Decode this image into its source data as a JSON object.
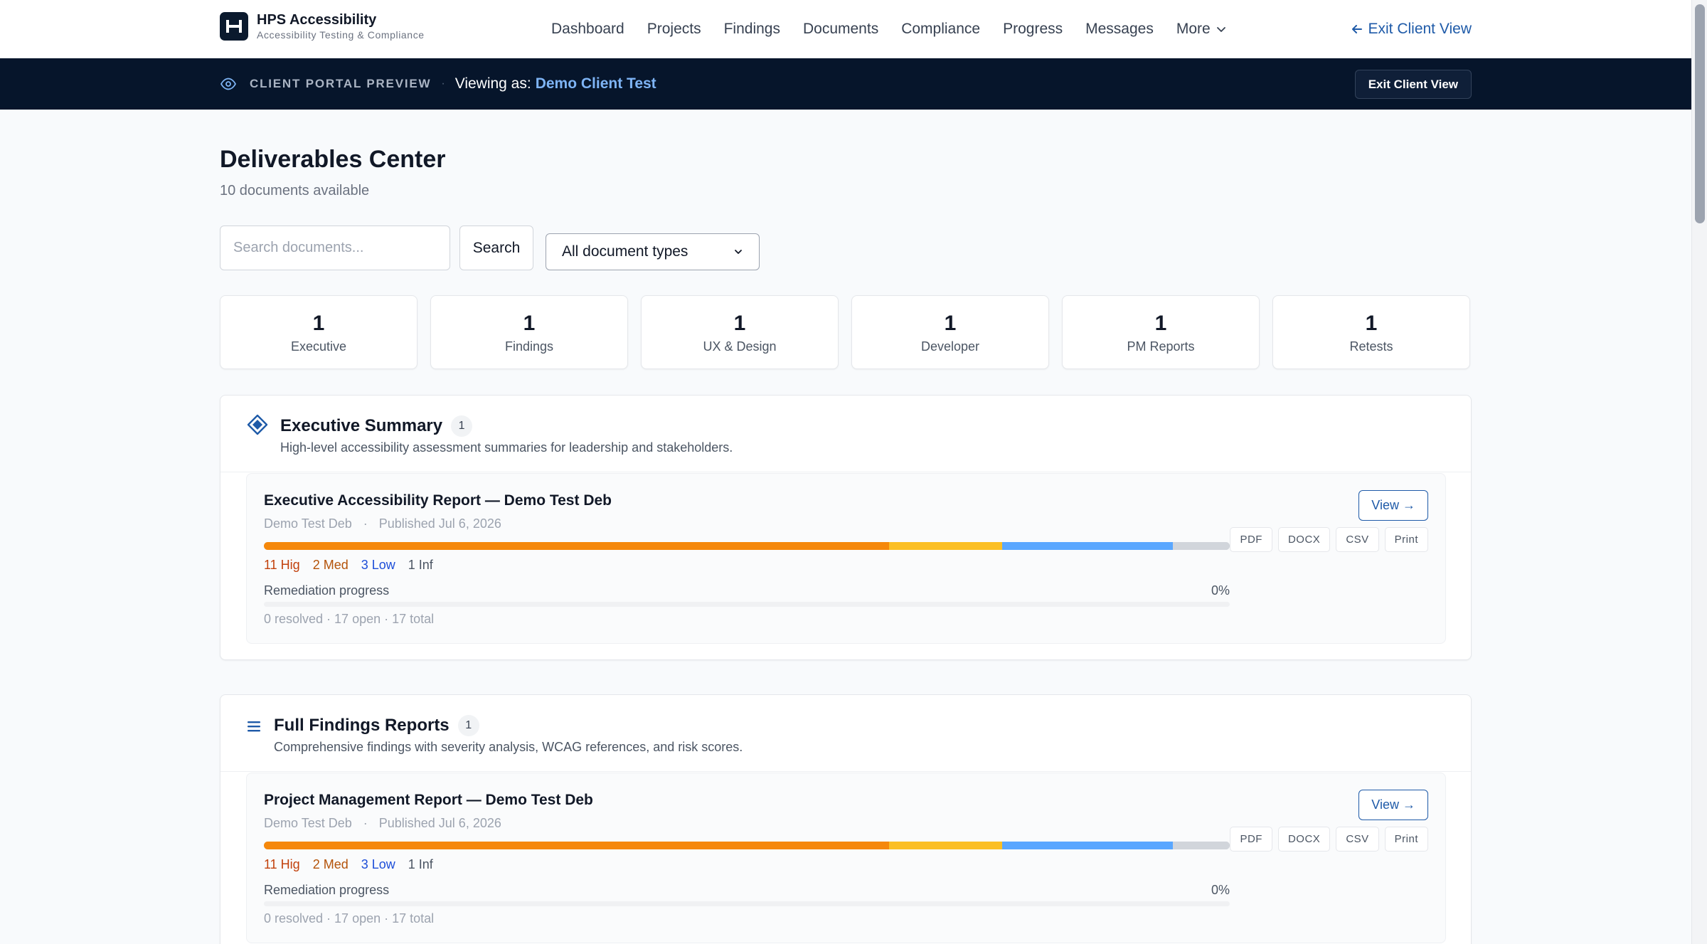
{
  "nav": {
    "brand_name": "HPS Accessibility",
    "brand_sub": "Accessibility Testing & Compliance",
    "links": [
      "Dashboard",
      "Projects",
      "Findings",
      "Documents",
      "Compliance",
      "Progress",
      "Messages"
    ],
    "more_label": "More",
    "exit_label": "Exit Client View"
  },
  "preview_bar": {
    "label": "CLIENT PORTAL PREVIEW",
    "dot": "·",
    "viewing_as": "Viewing as:",
    "client_name": "Demo Client Test",
    "exit_button": "Exit Client View"
  },
  "page": {
    "title": "Deliverables Center",
    "subtitle": "10 documents available"
  },
  "search": {
    "placeholder": "Search documents...",
    "value": "",
    "button_label": "Search",
    "type_select_value": "All document types"
  },
  "stats": [
    {
      "value": "1",
      "label": "Executive"
    },
    {
      "value": "1",
      "label": "Findings"
    },
    {
      "value": "1",
      "label": "UX & Design"
    },
    {
      "value": "1",
      "label": "Developer"
    },
    {
      "value": "1",
      "label": "PM Reports"
    },
    {
      "value": "1",
      "label": "Retests"
    }
  ],
  "sections": [
    {
      "icon": "diamond-icon",
      "title": "Executive Summary",
      "count": "1",
      "description": "High-level accessibility assessment summaries for leadership and stakeholders.",
      "document": {
        "title": "Executive Accessibility Report — Demo Test Deb",
        "author": "Demo Test Deb",
        "meta_sep": "·",
        "published": "Published Jul 6, 2026",
        "severity": [
          {
            "label": "11 Hig",
            "count": 11,
            "color": "#f5880b",
            "text_color": "#c2410c"
          },
          {
            "label": "2 Med",
            "count": 2,
            "color": "#fbbf24",
            "text_color": "#b45309"
          },
          {
            "label": "3 Low",
            "count": 3,
            "color": "#5aa7ff",
            "text_color": "#1d4ed8"
          },
          {
            "label": "1 Inf",
            "count": 1,
            "color": "#d1d5db",
            "text_color": "#4b5563"
          }
        ],
        "remediation_label": "Remediation progress",
        "remediation_pct": "0%",
        "remediation_value": 0,
        "counts": "0 resolved · 17 open · 17 total",
        "view_label": "View →",
        "formats": [
          "PDF",
          "DOCX",
          "CSV",
          "Print"
        ]
      }
    },
    {
      "icon": "list-icon",
      "title": "Full Findings Reports",
      "count": "1",
      "description": "Comprehensive findings with severity analysis, WCAG references, and risk scores.",
      "document": {
        "title": "Project Management Report — Demo Test Deb",
        "author": "Demo Test Deb",
        "meta_sep": "·",
        "published": "Published Jul 6, 2026",
        "severity": [
          {
            "label": "11 Hig",
            "count": 11,
            "color": "#f5880b",
            "text_color": "#c2410c"
          },
          {
            "label": "2 Med",
            "count": 2,
            "color": "#fbbf24",
            "text_color": "#b45309"
          },
          {
            "label": "3 Low",
            "count": 3,
            "color": "#5aa7ff",
            "text_color": "#1d4ed8"
          },
          {
            "label": "1 Inf",
            "count": 1,
            "color": "#d1d5db",
            "text_color": "#4b5563"
          }
        ],
        "remediation_label": "Remediation progress",
        "remediation_pct": "0%",
        "remediation_value": 0,
        "counts": "0 resolved · 17 open · 17 total",
        "view_label": "View →",
        "formats": [
          "PDF",
          "DOCX",
          "CSV",
          "Print"
        ]
      }
    }
  ],
  "colors": {
    "accent": "#1e5aa8",
    "preview_bg": "#06152b",
    "client_name": "#7eb4f5"
  }
}
